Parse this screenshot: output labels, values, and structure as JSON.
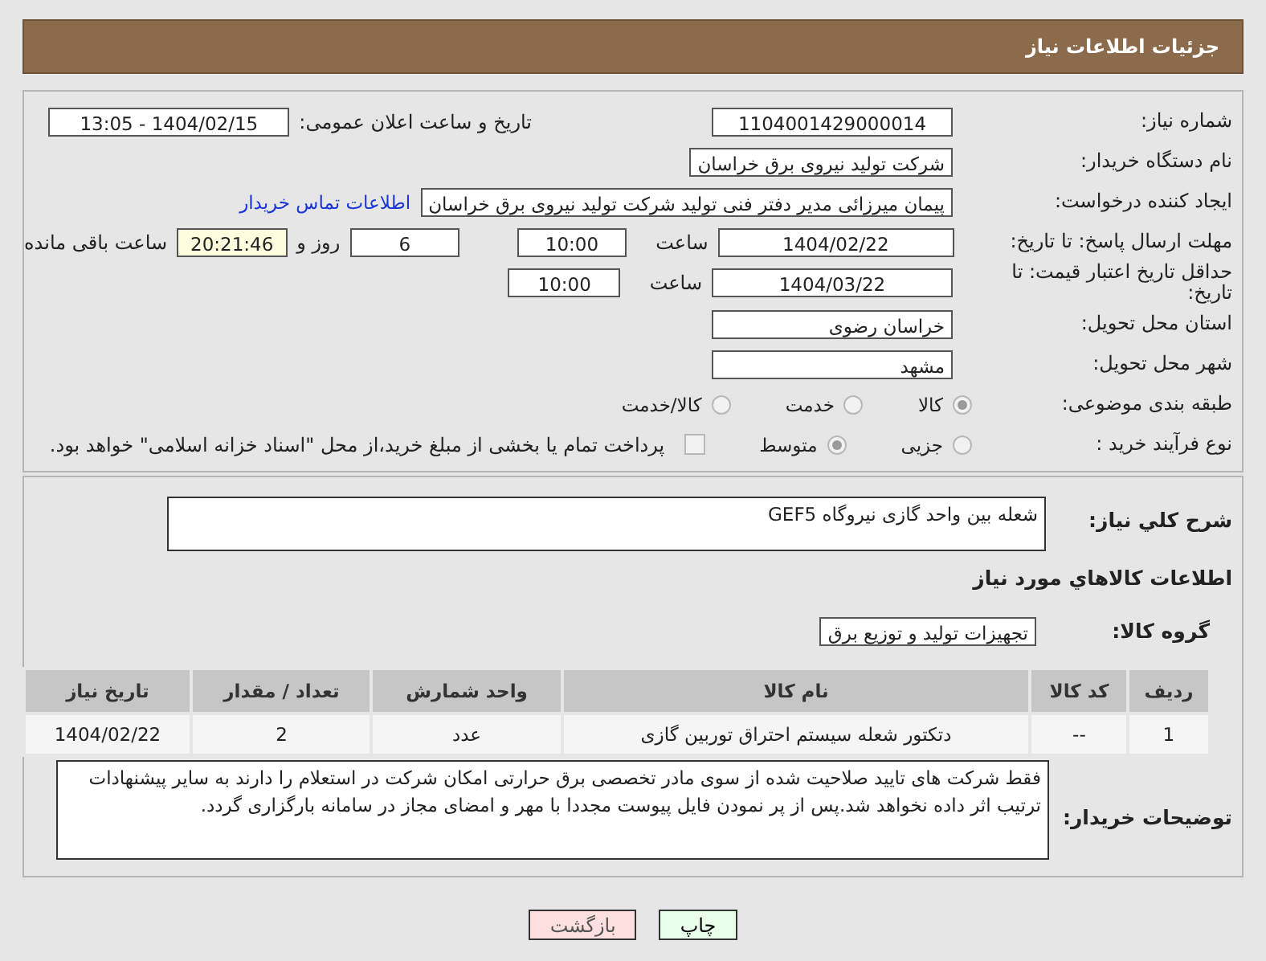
{
  "header": {
    "title": "جزئیات اطلاعات نیاز"
  },
  "need_number": {
    "label": "شماره نیاز:",
    "value": "1104001429000014"
  },
  "announce": {
    "label": "تاریخ و ساعت اعلان عمومی:",
    "value": "1404/02/15 - 13:05"
  },
  "buyer_org": {
    "label": "نام دستگاه خریدار:",
    "value": "شرکت تولید نیروی برق خراسان"
  },
  "requester": {
    "label": "ایجاد کننده درخواست:",
    "value": "پیمان میرزائی مدیر دفتر فنی تولید شرکت تولید نیروی برق خراسان",
    "link": "اطلاعات تماس خریدار"
  },
  "reply_deadline": {
    "label": "مهلت ارسال پاسخ: تا تاریخ:",
    "date": "1404/02/22",
    "time_label": "ساعت",
    "time": "10:00",
    "days": "6",
    "days_label": "روز و",
    "remaining": "20:21:46",
    "remaining_label": "ساعت باقی مانده"
  },
  "price_validity": {
    "label": "حداقل تاریخ اعتبار قیمت: تا تاریخ:",
    "date": "1404/03/22",
    "time_label": "ساعت",
    "time": "10:00"
  },
  "province": {
    "label": "استان محل تحویل:",
    "value": "خراسان رضوی"
  },
  "city": {
    "label": "شهر محل تحویل:",
    "value": "مشهد"
  },
  "category": {
    "label": "طبقه بندی موضوعی:",
    "options": [
      {
        "label": "کالا",
        "selected": true
      },
      {
        "label": "خدمت",
        "selected": false
      },
      {
        "label": "کالا/خدمت",
        "selected": false
      }
    ]
  },
  "process": {
    "label": "نوع فرآیند خرید :",
    "options": [
      {
        "label": "جزیی",
        "selected": false
      },
      {
        "label": "متوسط",
        "selected": true
      }
    ],
    "treasury": {
      "checked": false,
      "label": "پرداخت تمام یا بخشی از مبلغ خرید،از محل \"اسناد خزانه اسلامی\" خواهد بود."
    }
  },
  "summary": {
    "label": "شرح کلي نياز:",
    "value": "شعله بین واحد گازی نیروگاه GEF5"
  },
  "goods_heading": "اطلاعات کالاهاي مورد نياز",
  "goods_group": {
    "label": "گروه کالا:",
    "value": "تجهیزات تولید و توزیع برق"
  },
  "table": {
    "columns": [
      "ردیف",
      "کد کالا",
      "نام کالا",
      "واحد شمارش",
      "تعداد / مقدار",
      "تاریخ نیاز"
    ],
    "rows": [
      [
        "1",
        "--",
        "دتکتور شعله سیستم احتراق توربین گازی",
        "عدد",
        "2",
        "1404/02/22"
      ]
    ]
  },
  "buyer_notes": {
    "label": "توضیحات خریدار:",
    "value": "فقط شرکت های تایید صلاحیت شده از سوی مادر تخصصی برق حرارتی امکان شرکت در استعلام را دارند به سایر پیشنهادات ترتیب اثر داده نخواهد شد.پس از پر نمودن فایل پیوست مجددا با مهر و امضای مجاز در سامانه بارگزاری گردد."
  },
  "buttons": [
    {
      "kind": "print",
      "label": "چاپ"
    },
    {
      "kind": "back",
      "label": "بازگشت"
    }
  ]
}
